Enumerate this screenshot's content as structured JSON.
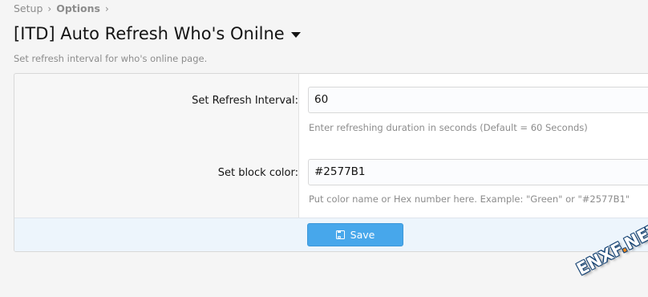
{
  "breadcrumb": {
    "items": [
      "Setup",
      "Options"
    ],
    "separator": "›"
  },
  "page": {
    "title": "[ITD] Auto Refresh Who's Onilne",
    "description": "Set refresh interval for who's online page."
  },
  "form": {
    "rows": [
      {
        "label": "Set Refresh Interval:",
        "value": "60",
        "hint": "Enter refreshing duration in seconds (Default = 60 Seconds)"
      },
      {
        "label": "Set block color:",
        "value": "#2577B1",
        "hint": "Put color name or Hex number here. Example: \"Green\" or \"#2577B1\""
      }
    ],
    "save_label": "Save"
  },
  "watermark": {
    "text_part1": "ENXF",
    "text_dot": ".",
    "text_part2": "NET"
  },
  "colors": {
    "accent_button": "#47a7eb",
    "submit_row_bg": "#edf5fc",
    "muted_text": "#8c8c8c"
  }
}
